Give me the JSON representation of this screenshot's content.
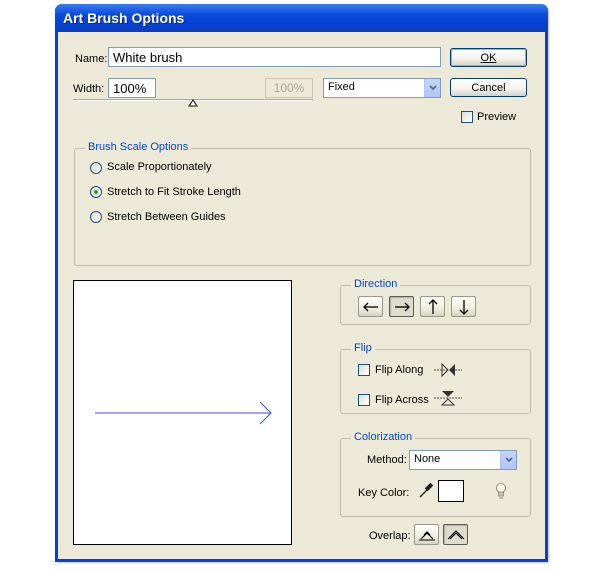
{
  "window": {
    "title": "Art Brush Options"
  },
  "name_field": {
    "label": "Name:",
    "value": "White brush"
  },
  "width_field": {
    "label": "Width:",
    "value": "100%",
    "max_value": "100%",
    "mode": "Fixed"
  },
  "buttons": {
    "ok": "OK",
    "cancel": "Cancel"
  },
  "preview_check": {
    "label": "Preview",
    "checked": false
  },
  "brush_scale": {
    "title": "Brush Scale Options",
    "options": [
      {
        "label": "Scale Proportionately",
        "selected": false
      },
      {
        "label": "Stretch to Fit Stroke Length",
        "selected": true
      },
      {
        "label": "Stretch Between Guides",
        "selected": false
      }
    ]
  },
  "direction": {
    "title": "Direction",
    "selected": "right"
  },
  "flip": {
    "title": "Flip",
    "along": {
      "label": "Flip Along",
      "checked": false
    },
    "across": {
      "label": "Flip Across",
      "checked": false
    }
  },
  "colorization": {
    "title": "Colorization",
    "method_label": "Method:",
    "method_value": "None",
    "key_color_label": "Key Color:",
    "key_color": "#ffffff"
  },
  "overlap": {
    "label": "Overlap:"
  },
  "colors": {
    "accent": "#0046d5",
    "titlebar": "#0a49d9",
    "preview_arrow": "#3355cc"
  }
}
